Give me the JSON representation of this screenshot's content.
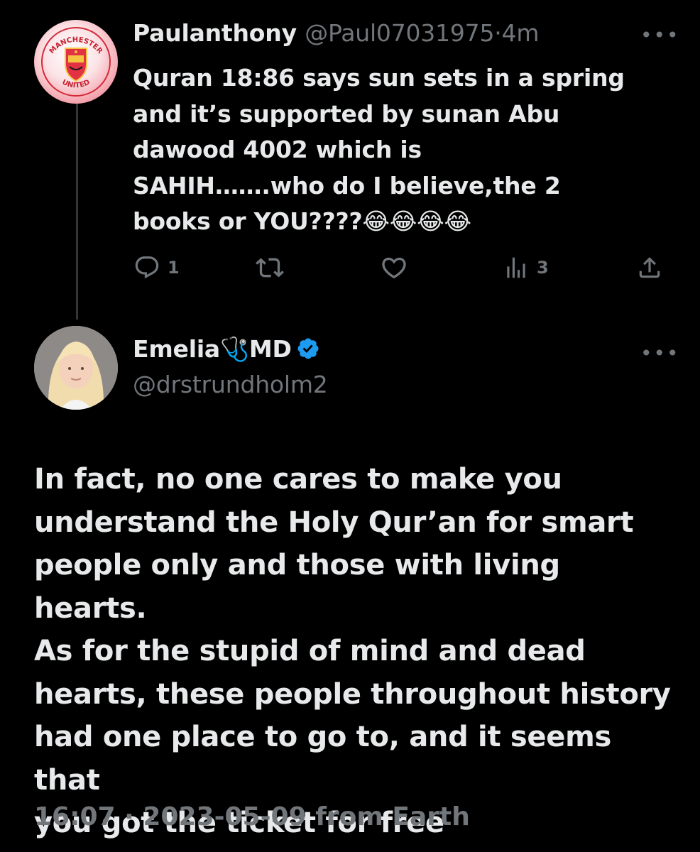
{
  "parent_tweet": {
    "display_name": "Paulanthony",
    "handle": "@Paul07031975",
    "separator": "·",
    "time_ago": "4m",
    "more_icon": "more-horizontal-icon",
    "avatar": {
      "icon": "manchester-united-crest",
      "text_top": "MANCHESTER",
      "text_bottom": "UNITED"
    },
    "text": "Quran 18:86 says sun sets in a spring\nand it’s supported by sunan Abu\ndawood 4002 which is\nSAHIH…….who do I believe,the 2\nbooks or YOU????😂😂😂😂",
    "actions": {
      "reply": {
        "icon": "reply-icon",
        "count": "1"
      },
      "retweet": {
        "icon": "retweet-icon",
        "count": ""
      },
      "like": {
        "icon": "heart-icon",
        "count": ""
      },
      "views": {
        "icon": "views-icon",
        "count": "3"
      },
      "share": {
        "icon": "share-icon"
      }
    }
  },
  "reply_tweet": {
    "display_name": "Emelia🩺MD",
    "verified_icon": "verified-badge-icon",
    "verified_color": "#1d9bf0",
    "handle": "@drstrundholm2",
    "more_icon": "more-horizontal-icon",
    "text": "In fact, no one cares to make you\nunderstand the Holy Qur’an for smart\npeople only and those with living hearts.\nAs for the stupid of mind and dead\nhearts, these people throughout history\nhad one place to go to, and it seems that\nyou got the ticket for free",
    "timestamp": "16:07",
    "separator": "·",
    "date": "2023-05-09",
    "source": "from Earth"
  },
  "colors": {
    "background": "#000000",
    "text_primary": "#e7e9ea",
    "text_secondary": "#71767b",
    "thread_line": "#333639"
  }
}
